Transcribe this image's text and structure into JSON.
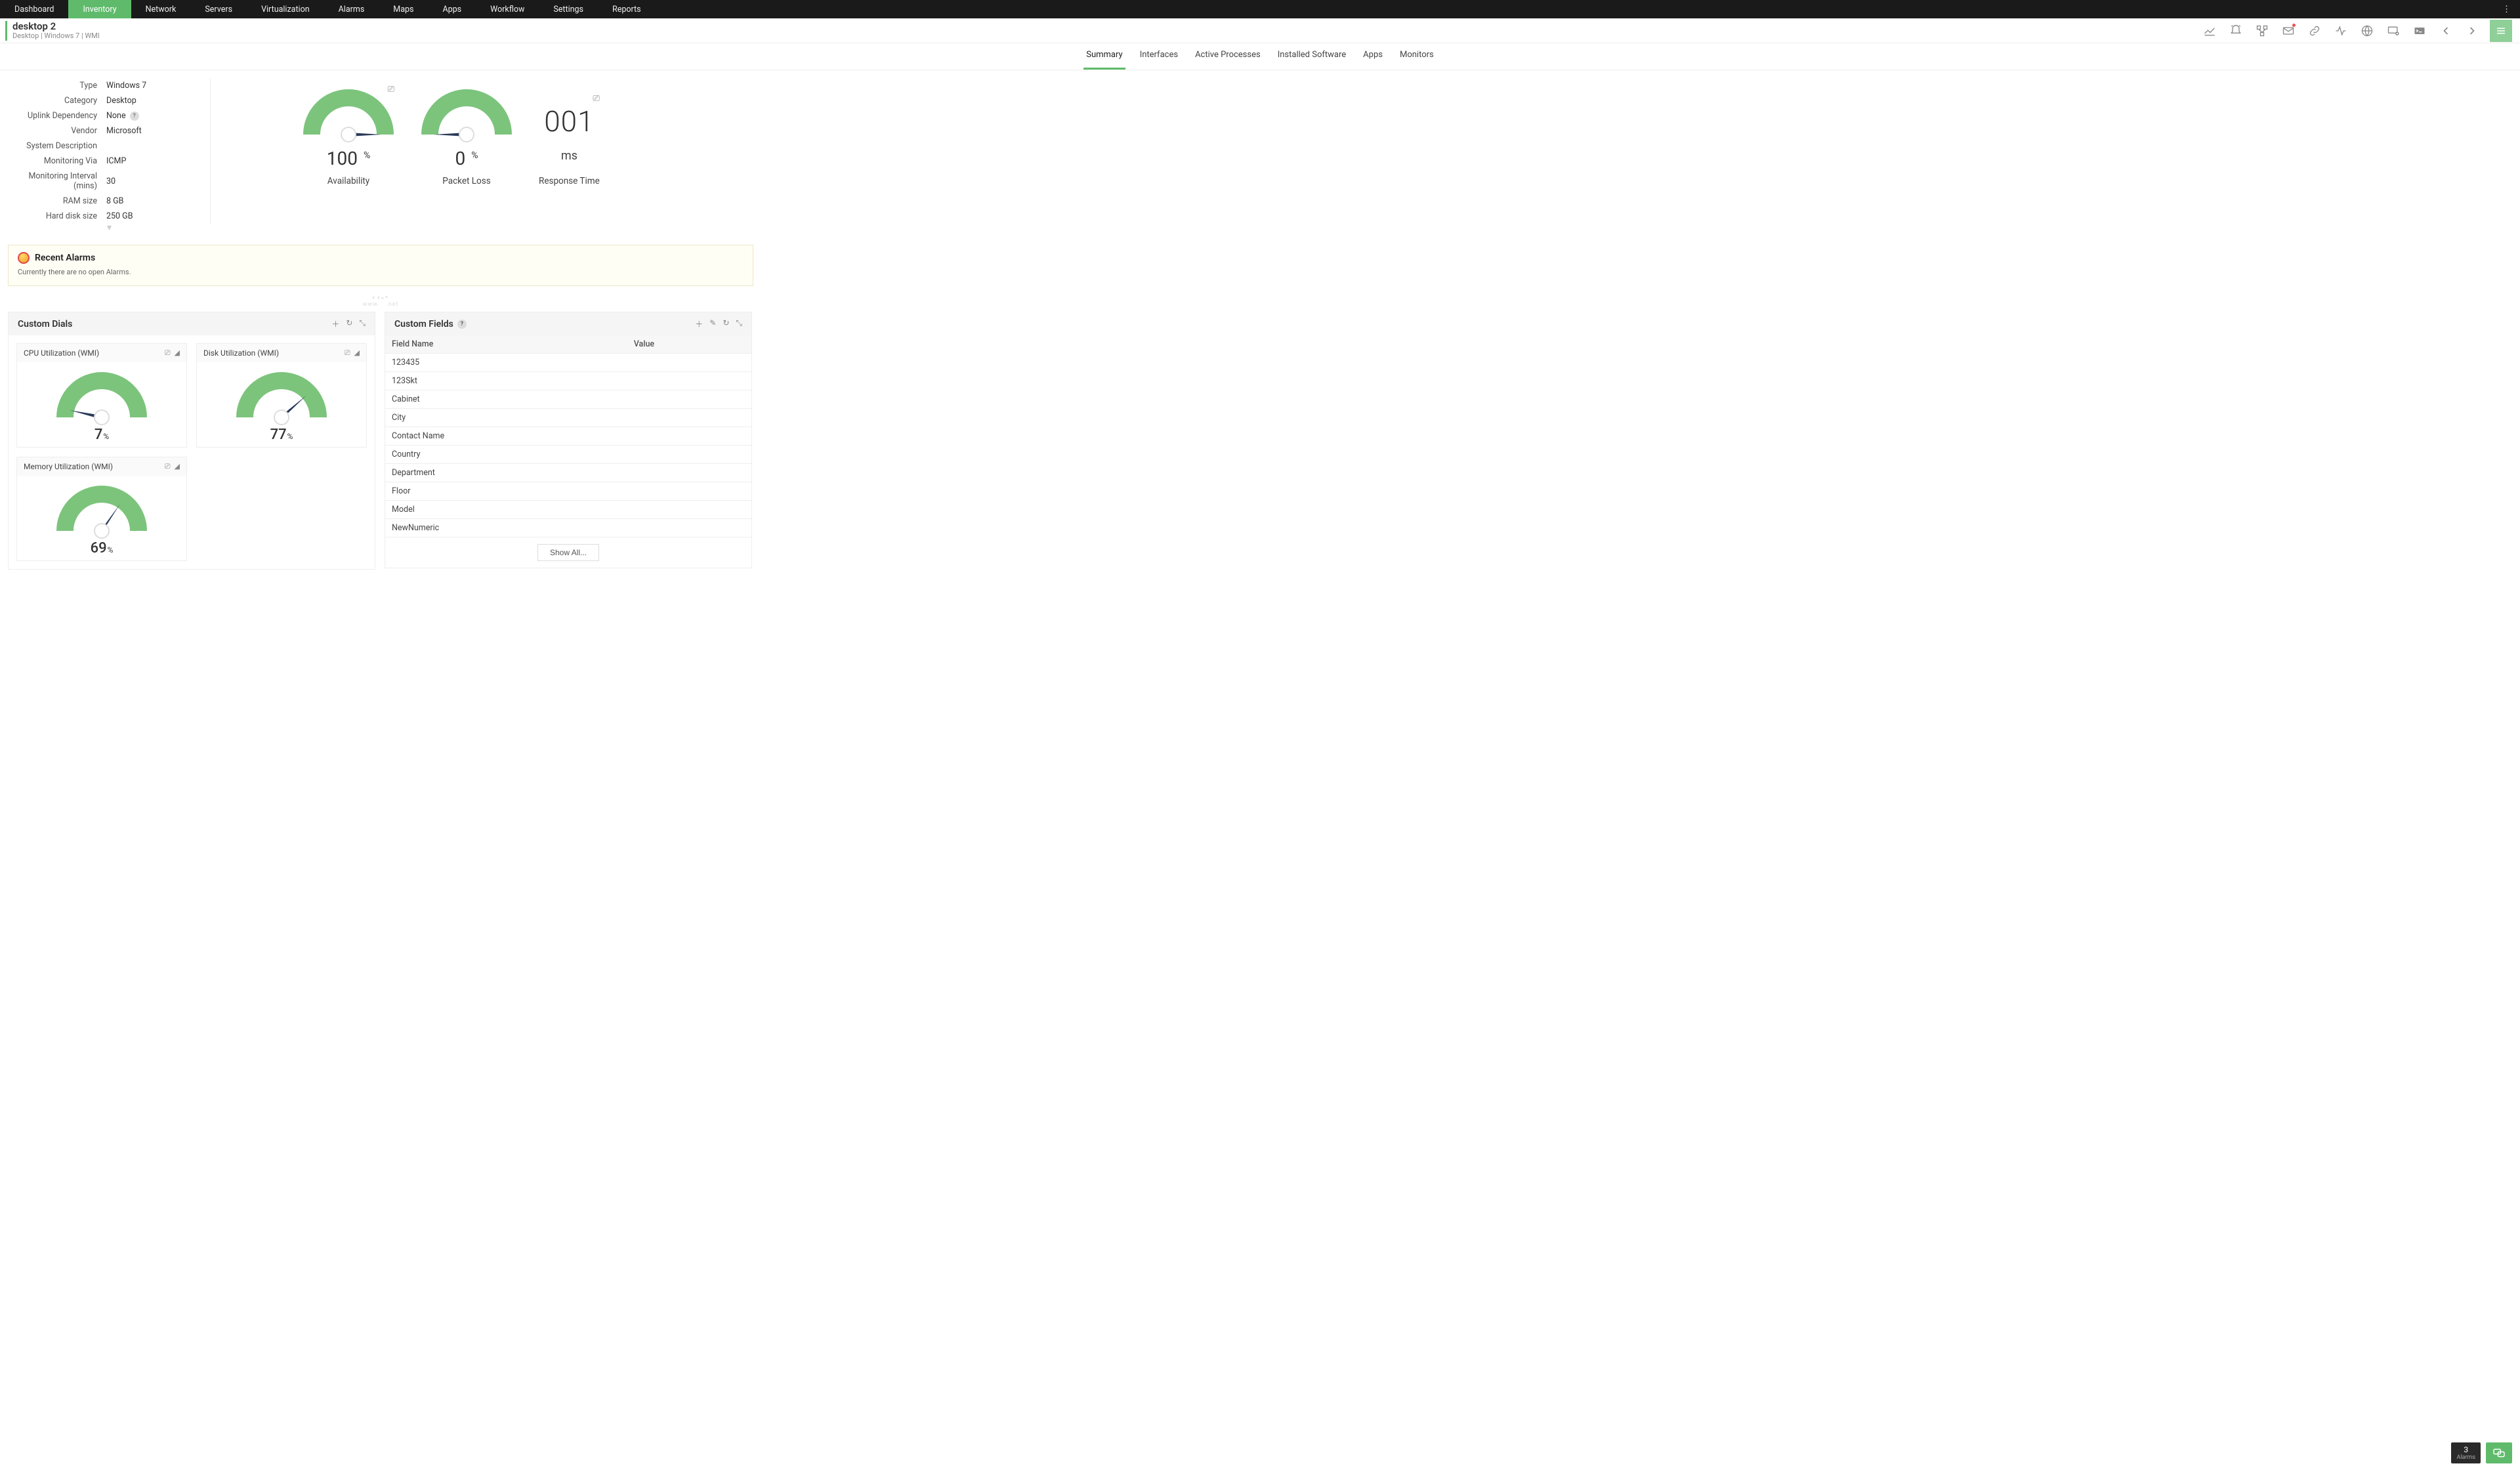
{
  "topnav": [
    "Dashboard",
    "Inventory",
    "Network",
    "Servers",
    "Virtualization",
    "Alarms",
    "Maps",
    "Apps",
    "Workflow",
    "Settings",
    "Reports"
  ],
  "topnav_active": 1,
  "device": {
    "title": "desktop 2",
    "meta": "Desktop  |  Windows 7  |  WMI"
  },
  "tabs": [
    "Summary",
    "Interfaces",
    "Active Processes",
    "Installed Software",
    "Apps",
    "Monitors"
  ],
  "tabs_active": 0,
  "specs": [
    {
      "label": "Type",
      "value": "Windows 7"
    },
    {
      "label": "Category",
      "value": "Desktop"
    },
    {
      "label": "Uplink Dependency",
      "value": "None",
      "help": true
    },
    {
      "label": "Vendor",
      "value": "Microsoft"
    },
    {
      "label": "System Description",
      "value": ""
    },
    {
      "label": "Monitoring Via",
      "value": "ICMP"
    },
    {
      "label": "Monitoring Interval (mins)",
      "value": "30"
    },
    {
      "label": "RAM size",
      "value": "8 GB"
    },
    {
      "label": "Hard disk size",
      "value": "250 GB"
    }
  ],
  "gauges": {
    "availability": {
      "value": "100",
      "unit": "%",
      "label": "Availability",
      "pct": 100
    },
    "packet_loss": {
      "value": "0",
      "unit": "%",
      "label": "Packet Loss",
      "pct": 0
    },
    "response": {
      "value": "001",
      "unit": "ms",
      "label": "Response Time"
    }
  },
  "alarms": {
    "title": "Recent Alarms",
    "empty": "Currently there are no open Alarms."
  },
  "custom_dials": {
    "title": "Custom Dials",
    "dials": [
      {
        "name": "CPU Utilization (WMI)",
        "value": "7",
        "unit": "%",
        "pct": 7
      },
      {
        "name": "Disk Utilization (WMI)",
        "value": "77",
        "unit": "%",
        "pct": 77
      },
      {
        "name": "Memory Utilization (WMI)",
        "value": "69",
        "unit": "%",
        "pct": 69
      }
    ]
  },
  "custom_fields": {
    "title": "Custom Fields",
    "columns": [
      "Field Name",
      "Value"
    ],
    "rows": [
      [
        "123435",
        ""
      ],
      [
        "123Skt",
        ""
      ],
      [
        "Cabinet",
        ""
      ],
      [
        "City",
        ""
      ],
      [
        "Contact Name",
        ""
      ],
      [
        "Country",
        ""
      ],
      [
        "Department",
        ""
      ],
      [
        "Floor",
        ""
      ],
      [
        "Model",
        ""
      ],
      [
        "NewNumeric",
        ""
      ]
    ],
    "show_all": "Show All..."
  },
  "footer": {
    "alarm_count": "3",
    "alarm_label": "Alarms"
  },
  "chart_data": [
    {
      "type": "gauge",
      "title": "Availability",
      "value": 100,
      "unit": "%",
      "range": [
        0,
        100
      ]
    },
    {
      "type": "gauge",
      "title": "Packet Loss",
      "value": 0,
      "unit": "%",
      "range": [
        0,
        100
      ]
    },
    {
      "type": "gauge",
      "title": "CPU Utilization (WMI)",
      "value": 7,
      "unit": "%",
      "range": [
        0,
        100
      ]
    },
    {
      "type": "gauge",
      "title": "Disk Utilization (WMI)",
      "value": 77,
      "unit": "%",
      "range": [
        0,
        100
      ]
    },
    {
      "type": "gauge",
      "title": "Memory Utilization (WMI)",
      "value": 69,
      "unit": "%",
      "range": [
        0,
        100
      ]
    }
  ]
}
